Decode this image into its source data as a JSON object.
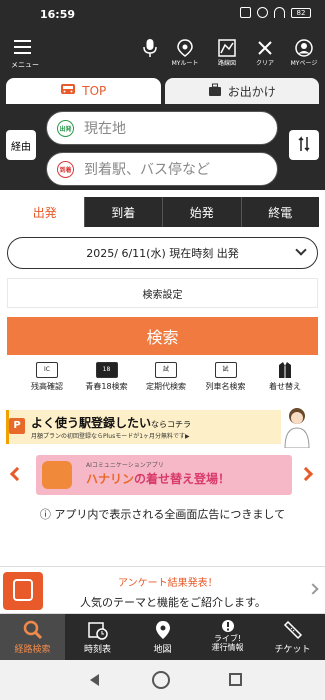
{
  "status": {
    "time": "16:59",
    "battery": "82"
  },
  "header": {
    "menu_label": "メニュー",
    "icons": [
      {
        "name": "microphone-icon",
        "label": ""
      },
      {
        "name": "my-route-icon",
        "label": "MYルート"
      },
      {
        "name": "route-map-icon",
        "label": "路線図"
      },
      {
        "name": "clear-icon",
        "label": "クリア"
      },
      {
        "name": "mypage-icon",
        "label": "MYページ"
      }
    ]
  },
  "tabs": [
    {
      "label": "TOP",
      "icon": "train-icon"
    },
    {
      "label": "お出かけ",
      "icon": "luggage-icon"
    }
  ],
  "search": {
    "via_label": "経由",
    "from_badge": "出発",
    "from_placeholder": "現在地",
    "to_badge": "到着",
    "to_placeholder": "到着駅、バス停など",
    "swap_icon": "swap-icon"
  },
  "modes": [
    "出発",
    "到着",
    "始発",
    "終電"
  ],
  "datetime": "2025/ 6/11(水) 現在時刻 出発",
  "settings_label": "検索設定",
  "search_button": "検索",
  "shortcuts": [
    {
      "label": "残高確認",
      "badge": "IC"
    },
    {
      "label": "青春18検索",
      "badge": "18"
    },
    {
      "label": "定期代検索",
      "badge": "試"
    },
    {
      "label": "列車名検索",
      "badge": "試"
    },
    {
      "label": "着せ替え",
      "badge": ""
    }
  ],
  "promo": {
    "main": "よく使う駅登録したい",
    "suffix": "ならコチラ",
    "sub": "月額プランの初回登録ならPlusモードが1ヶ月分無料です▶",
    "logo": "P"
  },
  "banner": {
    "top": "AIコミュニケーションアプリ",
    "brand": "ハナリン",
    "main": "の着せ替え登場！"
  },
  "notice": "ⓘ アプリ内で表示される全画面広告につきまして",
  "survey": {
    "title": "アンケート結果発表！",
    "body": "人気のテーマと機能をご紹介します。"
  },
  "bottom_nav": [
    {
      "label": "経路検索",
      "icon": "search-icon"
    },
    {
      "label": "時刻表",
      "icon": "timetable-icon"
    },
    {
      "label": "地図",
      "icon": "map-pin-icon"
    },
    {
      "label": "ライブ!\n運行情報",
      "icon": "alert-icon"
    },
    {
      "label": "チケット",
      "icon": "ticket-icon"
    }
  ],
  "colors": {
    "accent": "#e85a2a",
    "dark": "#2a2a2a",
    "button": "#f07a40"
  }
}
